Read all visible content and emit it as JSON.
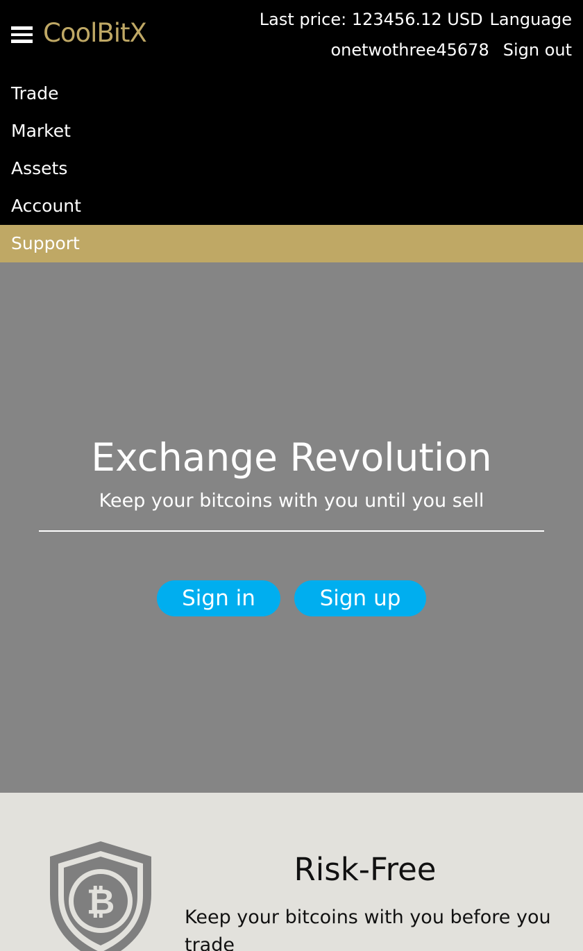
{
  "header": {
    "logo": "CoolBitX",
    "last_price": "Last price: 123456.12 USD",
    "language": "Language",
    "username": "onetwothree45678",
    "sign_out": "Sign out"
  },
  "nav": {
    "items": [
      {
        "label": "Trade"
      },
      {
        "label": "Market"
      },
      {
        "label": "Assets"
      },
      {
        "label": "Account"
      },
      {
        "label": "Support",
        "active": true
      }
    ]
  },
  "hero": {
    "title": "Exchange Revolution",
    "subtitle": "Keep your bitcoins with you until you sell",
    "sign_in": "Sign in",
    "sign_up": "Sign up"
  },
  "feature": {
    "icon": "bitcoin-shield-icon",
    "title": "Risk-Free",
    "text": "Keep your bitcoins with you before you trade"
  },
  "colors": {
    "brand_gold": "#bfa865",
    "button_blue": "#00aeef",
    "hero_gray": "#858585",
    "section_bg": "#e2e1dc",
    "header_bg": "#000000"
  }
}
